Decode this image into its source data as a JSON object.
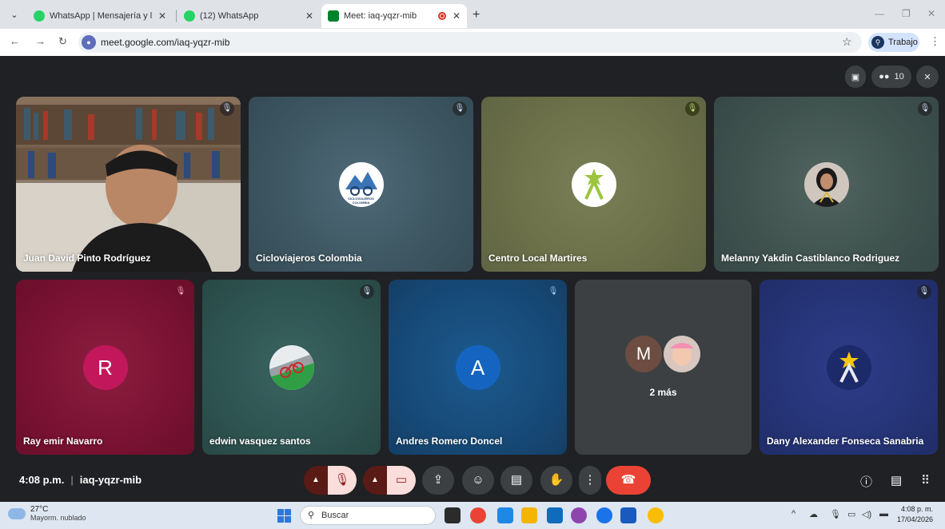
{
  "browser": {
    "tabs": [
      {
        "title": "WhatsApp | Mensajería y llamac",
        "icon": "whatsapp-icon"
      },
      {
        "title": "(12) WhatsApp",
        "icon": "whatsapp-icon"
      },
      {
        "title": "Meet: iaq-yqzr-mib",
        "icon": "google-meet-icon",
        "active": true
      }
    ],
    "url": "meet.google.com/iaq-yqzr-mib",
    "profile_label": "Trabajo"
  },
  "meet": {
    "participant_count": "10",
    "time": "4:08 p.m.",
    "meeting_code": "iaq-yqzr-mib",
    "participants": [
      {
        "name": "Juan David Pinto Rodríguez",
        "kind": "video",
        "muted": true
      },
      {
        "name": "Cicloviajeros Colombia",
        "kind": "logo",
        "logo_text": "CICLOVIAJEROS COLOMBIA",
        "muted": true
      },
      {
        "name": "Centro Local Martires",
        "kind": "logo",
        "muted": true
      },
      {
        "name": "Melanny Yakdin Castiblanco Rodriguez",
        "kind": "photo",
        "muted": true
      },
      {
        "name": "Ray emir Navarro",
        "kind": "letter",
        "letter": "R",
        "muted": true
      },
      {
        "name": "edwin vasquez santos",
        "kind": "logo",
        "muted": true
      },
      {
        "name": "Andres Romero Doncel",
        "kind": "letter",
        "letter": "A",
        "muted": true
      },
      {
        "name": "",
        "kind": "overflow",
        "letter": "M",
        "overflow_label": "2 más"
      },
      {
        "name": "Dany Alexander Fonseca Sanabria",
        "kind": "logo",
        "muted": true
      }
    ]
  },
  "taskbar": {
    "temperature": "27°C",
    "weather": "Mayorm. nublado",
    "search_placeholder": "Buscar",
    "time": "4:08 p. m.",
    "date": "17/04/2026"
  },
  "colors": {
    "meet_bg": "#202124",
    "hangup_red": "#ea4335",
    "tile_blue_gray": "#3f5863",
    "tile_olive": "#6b7049",
    "tile_crimson": "#7a1233",
    "tile_teal": "#2e5452",
    "tile_navy": "#174a78",
    "tile_indigo": "#263477"
  }
}
